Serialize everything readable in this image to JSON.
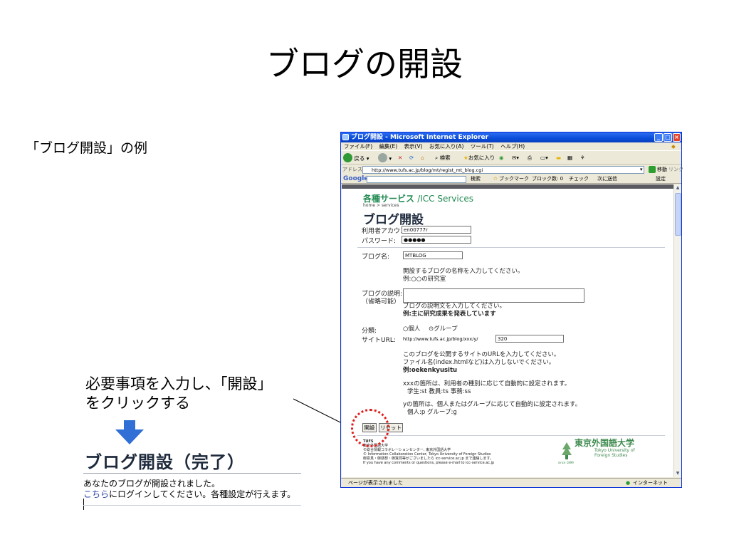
{
  "slide": {
    "title": "ブログの開設",
    "subtitle": "「ブログ開設」の例",
    "instruction_line1": "必要事項を入力し、「開設」",
    "instruction_line2": "をクリックする"
  },
  "done": {
    "title": "ブログ開設（完了）",
    "line1": "あなたのブログが開設されました。",
    "link": "こちら",
    "line2_rest": "にログインしてください。各種設定が行えます。"
  },
  "browser": {
    "title": "ブログ開設 - Microsoft Internet Explorer",
    "menu": [
      "ファイル(F)",
      "編集(E)",
      "表示(V)",
      "お気に入り(A)",
      "ツール(T)",
      "ヘルプ(H)"
    ],
    "toolbar": {
      "back": "戻る",
      "search": "検索",
      "favorites": "お気に入り"
    },
    "address_label": "アドレス(D)",
    "address_url": "http://www.tufs.ac.jp/blog/mt/regist_mt_blog.cgi",
    "go_label": "移動",
    "links_label": "リンク",
    "google": {
      "logo": "Google",
      "search": "検索",
      "bookmarks": "ブックマーク",
      "blocked": "ブロック数: 0",
      "check": "チェック",
      "send": "次に送信",
      "settings": "設定"
    },
    "status": "ページが表示されました",
    "zone": "インターネット"
  },
  "page": {
    "services_ja": "各種サービス",
    "services_en": "/ICC Services",
    "breadcrumb": "home > services",
    "heading": "ブログ開設",
    "account_label": "利用者アカウント:",
    "account_value": "en00777r",
    "password_label": "パスワード:",
    "password_value": "●●●●●",
    "blogname_label": "ブログ名:",
    "blogname_value": "MTBLOG",
    "blogname_help": "開設するブログの名称を入力してください。",
    "blogname_example": "例:○○の研究室",
    "desc_label1": "ブログの説明:",
    "desc_label2": "（省略可能）",
    "desc_help": "ブログの説明文を入力してください。",
    "desc_example": "例:主に研究成果を発表しています",
    "category_label": "分類:",
    "category_options": [
      "○個人",
      "⊙グループ"
    ],
    "siteurl_label": "サイトURL:",
    "siteurl_prefix": "http://www.tufs.ac.jp/blog/xxx/y/",
    "siteurl_value": "320",
    "siteurl_help1": "このブログを公開するサイトのURLを入力してください。",
    "siteurl_help2": "ファイル名(index.htmlなど)は入力しないでください。",
    "siteurl_example": "例:oekenkyusitu",
    "xxx_help1": "xxxの箇所は、利用者の種別に応じて自動的に設定されます。",
    "xxx_help2": "学生:st  教員:ts  事務:ss",
    "y_help1": "yの箇所は、個人またはグループに応じて自動的に設定されます。",
    "y_help2": "個人:p  グループ:g",
    "open_button": "開設",
    "reset_button": "リセット",
    "footer": [
      "TUFS",
      "東京外国語大学",
      "©総合情報コラボレーションセンター, 東京外国語大学",
      "© Information Collaboration Center, Tokyo University of Foreign Studies",
      "御意見・御感想・御質問等がございましたら icc-service.ac.jp まで連絡します。",
      "If you have any comments or questions, please e-mail to icc-service.ac.jp"
    ],
    "univ_name": "東京外国語大学",
    "univ_en1": "Tokyo University of",
    "univ_en2": "Foreign Studies",
    "univ_since": "since 1899"
  },
  "colors": {
    "accent": "#2f6fd6",
    "ie_title": "#0a4dd8",
    "services_green": "#218a52",
    "highlight": "#e02020"
  }
}
